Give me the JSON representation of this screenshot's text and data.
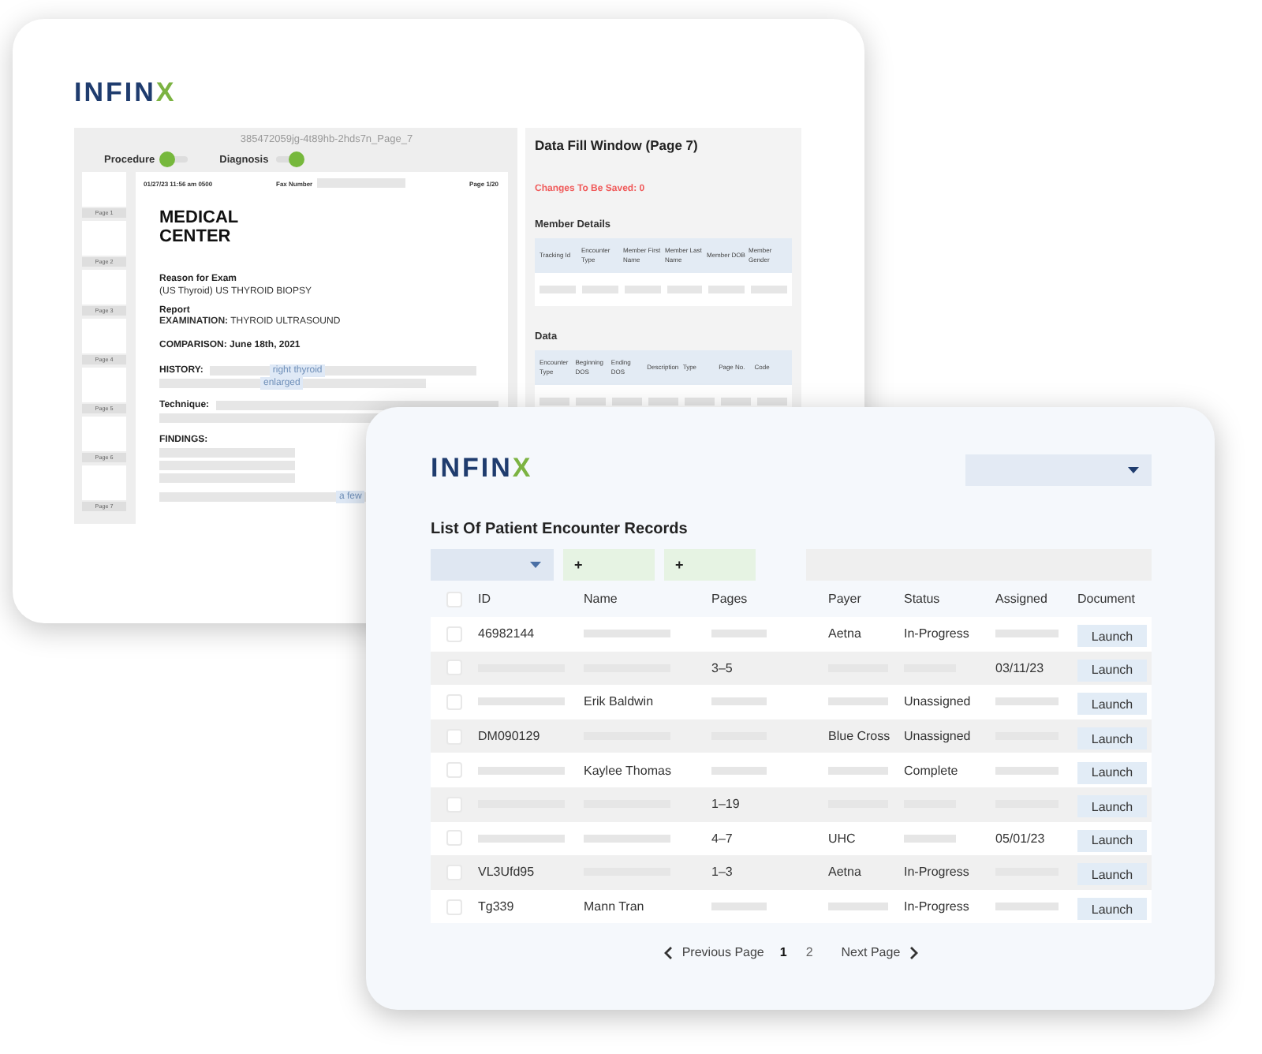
{
  "back_window": {
    "logo": {
      "main": "INFIN",
      "accent": "X"
    },
    "document_viewer": {
      "file_name": "385472059jg-4t89hb-2hds7n_Page_7",
      "toggles": [
        {
          "label": "Procedure",
          "on": false
        },
        {
          "label": "Diagnosis",
          "on": true
        }
      ],
      "pages": [
        {
          "label": "Page 1"
        },
        {
          "label": "Page 2"
        },
        {
          "label": "Page 3"
        },
        {
          "label": "Page 4"
        },
        {
          "label": "Page 5"
        },
        {
          "label": "Page 6"
        },
        {
          "label": "Page 7"
        }
      ],
      "page_header": {
        "timestamp": "01/27/23 11:56 am 0500",
        "fax_label": "Fax Number",
        "page_count": "Page 1/20"
      },
      "heading": "MEDICAL CENTER",
      "reason_label": "Reason for Exam",
      "reason": "(US Thyroid) US THYROID BIOPSY",
      "report_label": "Report",
      "examination": "**EXAMINATION:** THYROID ULTRASOUND",
      "comparison": "COMPARISON: June 18th, 2021",
      "history_label": "HISTORY:",
      "history_highlights": [
        "right thyroid",
        "enlarged"
      ],
      "technique_label": "Technique:",
      "findings_label": "FINDINGS:",
      "findings_highlight": "a few"
    },
    "data_fill": {
      "title": "Data Fill Window (Page 7)",
      "changes": "Changes To Be Saved: 0",
      "member_details": {
        "title": "Member Details",
        "columns": [
          "Tracking Id",
          "Encounter Type",
          "Member First Name",
          "Member Last Name",
          "Member DOB",
          "Member Gender"
        ]
      },
      "data": {
        "title": "Data",
        "columns": [
          "Encounter Type",
          "Beginning DOS",
          "Ending DOS",
          "Description",
          "Type",
          "Page No.",
          "Code"
        ]
      }
    }
  },
  "front_window": {
    "logo": {
      "main": "INFIN",
      "accent": "X"
    },
    "title": "List Of Patient Encounter Records",
    "filters": [
      {
        "kind": "dropdown"
      },
      {
        "kind": "add",
        "label": "+"
      },
      {
        "kind": "add",
        "label": "+"
      },
      {
        "kind": "search"
      }
    ],
    "table": {
      "select_all_checked": false,
      "columns": [
        "ID",
        "Name",
        "Pages",
        "Payer",
        "Status",
        "Assigned",
        "Document"
      ],
      "rows": [
        {
          "checked": false,
          "cells": [
            "46982144",
            null,
            null,
            "Aetna",
            "In-Progress",
            null
          ],
          "action": "Launch"
        },
        {
          "checked": false,
          "cells": [
            null,
            null,
            "3–5",
            null,
            null,
            "03/11/23"
          ],
          "action": "Launch"
        },
        {
          "checked": false,
          "cells": [
            null,
            "Erik Baldwin",
            null,
            null,
            "Unassigned",
            null
          ],
          "action": "Launch"
        },
        {
          "checked": false,
          "cells": [
            "DM090129",
            null,
            null,
            "Blue Cross",
            "Unassigned",
            null
          ],
          "action": "Launch"
        },
        {
          "checked": false,
          "cells": [
            null,
            "Kaylee Thomas",
            null,
            null,
            "Complete",
            null
          ],
          "action": "Launch"
        },
        {
          "checked": false,
          "cells": [
            null,
            null,
            "1–19",
            null,
            null,
            null
          ],
          "action": "Launch"
        },
        {
          "checked": false,
          "cells": [
            null,
            null,
            "4–7",
            "UHC",
            null,
            "05/01/23"
          ],
          "action": "Launch"
        },
        {
          "checked": false,
          "cells": [
            "VL3Ufd95",
            null,
            "1–3",
            "Aetna",
            "In-Progress",
            null
          ],
          "action": "Launch"
        },
        {
          "checked": false,
          "cells": [
            "Tg339",
            "Mann Tran",
            null,
            null,
            "In-Progress",
            null
          ],
          "action": "Launch"
        }
      ]
    },
    "pagination": {
      "previous": "Previous Page",
      "pages": [
        {
          "label": "1",
          "selected": true
        },
        {
          "label": "2",
          "selected": false
        }
      ],
      "next": "Next Page"
    }
  }
}
